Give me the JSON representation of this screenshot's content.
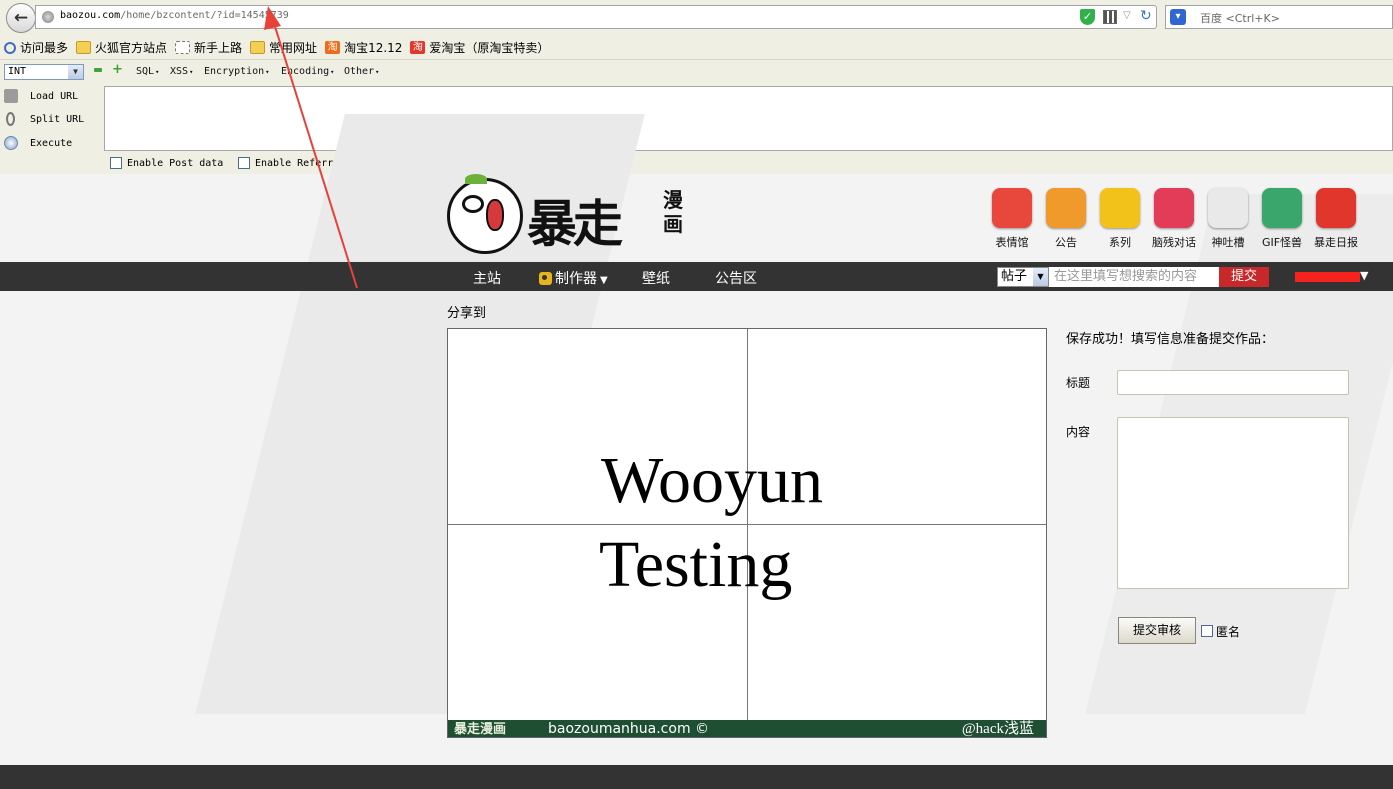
{
  "browser": {
    "url_host": "baozou.com",
    "url_path": "/home/bzcontent/?id=14545739",
    "search_placeholder": "百度 <Ctrl+K>",
    "bookmarks": [
      {
        "label": "访问最多",
        "icon": "search-icon"
      },
      {
        "label": "火狐官方站点",
        "icon": "folder-icon"
      },
      {
        "label": "新手上路",
        "icon": "dashed-page-icon"
      },
      {
        "label": "常用网址",
        "icon": "folder-icon"
      },
      {
        "label": "淘宝12.12",
        "icon": "taobao-icon"
      },
      {
        "label": "爱淘宝（原淘宝特卖）",
        "icon": "aitaobao-icon"
      }
    ]
  },
  "hackbar": {
    "type_select": "INT",
    "menus": [
      "SQL",
      "XSS",
      "Encryption",
      "Encoding",
      "Other"
    ],
    "actions": [
      "Load URL",
      "Split URL",
      "Execute"
    ],
    "checks": [
      "Enable Post data",
      "Enable Referrer"
    ]
  },
  "site": {
    "logo_text": "暴走",
    "logo_sub": [
      "漫",
      "画"
    ],
    "features": [
      {
        "label": "表情馆",
        "color": "#e8473c",
        "icon": "face-icon"
      },
      {
        "label": "公告",
        "color": "#f09a2b",
        "icon": "notice-icon"
      },
      {
        "label": "系列",
        "color": "#f2c21a",
        "icon": "series-icon"
      },
      {
        "label": "脑残对话",
        "color": "#e23c58",
        "icon": "vs-icon"
      },
      {
        "label": "神吐槽",
        "color": "#e9e9e9",
        "icon": "cat-icon"
      },
      {
        "label": "GIF怪兽",
        "color": "#3aa66b",
        "icon": "monster-icon"
      },
      {
        "label": "暴走日报",
        "color": "#e0362b",
        "icon": "daily-icon"
      }
    ],
    "nav": [
      "主站",
      "制作器",
      "壁纸",
      "公告区"
    ],
    "search": {
      "select": "帖子",
      "placeholder": "在这里填写想搜索的内容",
      "submit": "提交"
    }
  },
  "content": {
    "share_label": "分享到",
    "canvas_text": [
      "Wooyun",
      "Testing"
    ],
    "canvas_footer": {
      "logo": "暴走漫画",
      "site": "baozoumanhua.com ©",
      "handle": "@hack浅蓝"
    },
    "form": {
      "status": "保存成功！填写信息准备提交作品：",
      "title_label": "标题",
      "content_label": "内容",
      "submit": "提交审核",
      "anonymous": "匿名"
    }
  },
  "colors": {
    "accent": "#c8282a",
    "navbar": "#333333",
    "annotation": "#e8413a",
    "footer_green": "#1f4f33"
  }
}
